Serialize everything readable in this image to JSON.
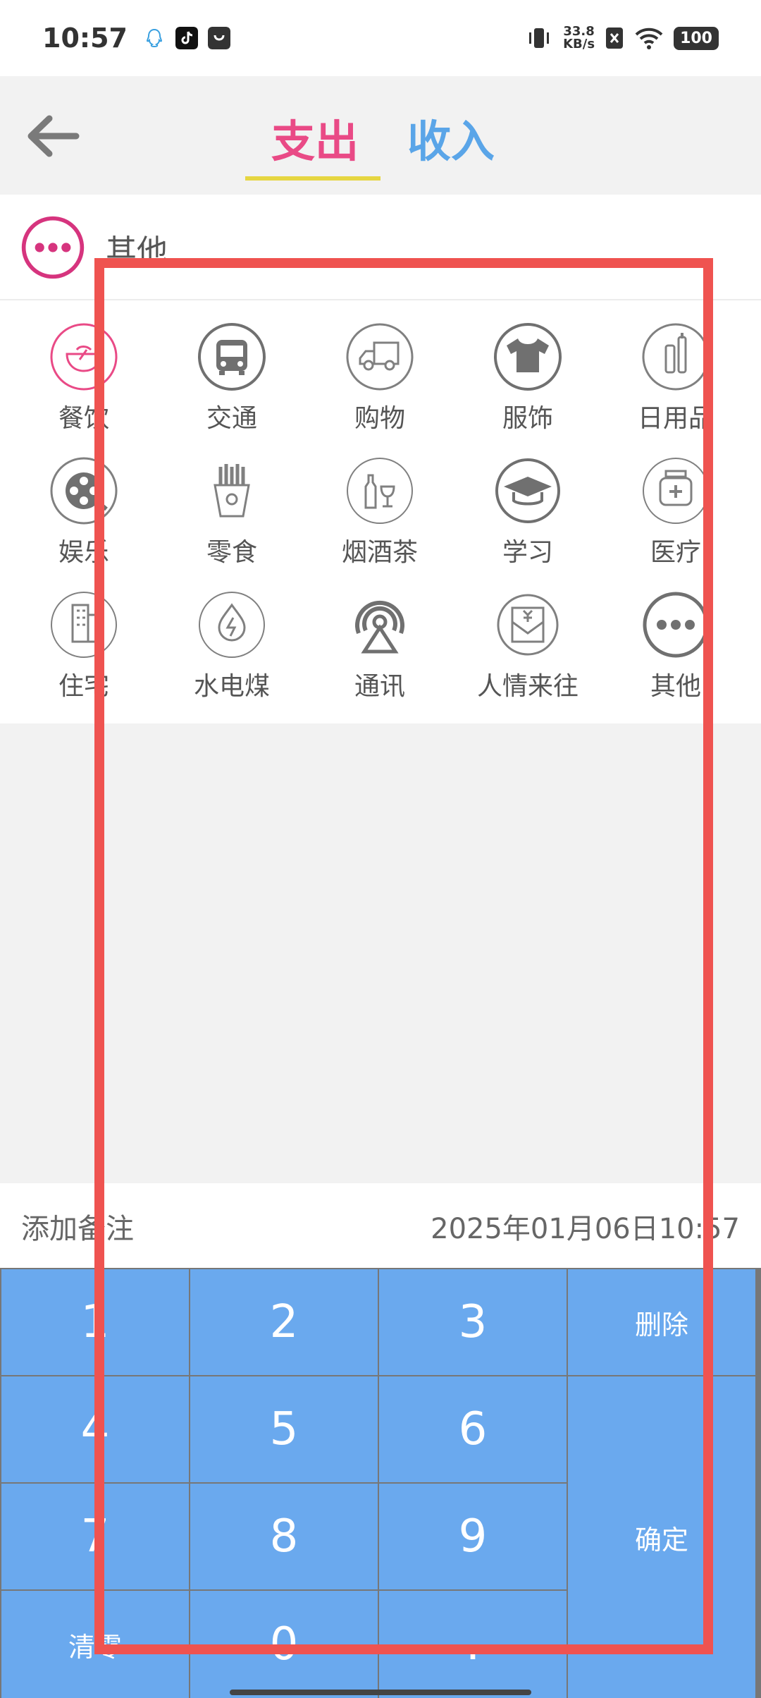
{
  "status_bar": {
    "time": "10:57",
    "net_speed_value": "33.8",
    "net_speed_unit": "KB/s",
    "battery": "100"
  },
  "header": {
    "tabs": [
      {
        "label": "支出",
        "active": true
      },
      {
        "label": "收入",
        "active": false
      }
    ]
  },
  "selected_category": {
    "label": "其他",
    "icon": "more-icon"
  },
  "categories": [
    {
      "label": "餐饮",
      "icon": "dining-icon",
      "selected": false
    },
    {
      "label": "交通",
      "icon": "bus-icon",
      "selected": false
    },
    {
      "label": "购物",
      "icon": "delivery-truck-icon",
      "selected": false
    },
    {
      "label": "服饰",
      "icon": "tshirt-icon",
      "selected": false
    },
    {
      "label": "日用品",
      "icon": "toiletries-icon",
      "selected": false
    },
    {
      "label": "娱乐",
      "icon": "film-reel-icon",
      "selected": false
    },
    {
      "label": "零食",
      "icon": "fries-icon",
      "selected": false
    },
    {
      "label": "烟酒茶",
      "icon": "wine-icon",
      "selected": false
    },
    {
      "label": "学习",
      "icon": "graduation-cap-icon",
      "selected": false
    },
    {
      "label": "医疗",
      "icon": "medicine-bottle-icon",
      "selected": false
    },
    {
      "label": "住宅",
      "icon": "building-icon",
      "selected": false
    },
    {
      "label": "水电煤",
      "icon": "energy-icon",
      "selected": false
    },
    {
      "label": "通讯",
      "icon": "antenna-icon",
      "selected": false
    },
    {
      "label": "人情来往",
      "icon": "red-envelope-icon",
      "selected": false
    },
    {
      "label": "其他",
      "icon": "more-icon",
      "selected": true
    }
  ],
  "note": {
    "label": "添加备注"
  },
  "date": {
    "value": "2025年01月06日10:57"
  },
  "keypad": {
    "k1": "1",
    "k2": "2",
    "k3": "3",
    "delete": "删除",
    "k4": "4",
    "k5": "5",
    "k6": "6",
    "confirm": "确定",
    "k7": "7",
    "k8": "8",
    "k9": "9",
    "clear": "清零",
    "k0": "0",
    "dot": "."
  },
  "colors": {
    "expense_accent": "#e94a86",
    "income_accent": "#5aa5e8",
    "tab_underline": "#e6d642",
    "keypad_blue": "#6aa9ee",
    "highlight_red": "#ef5350",
    "icon_gray": "#808080"
  }
}
